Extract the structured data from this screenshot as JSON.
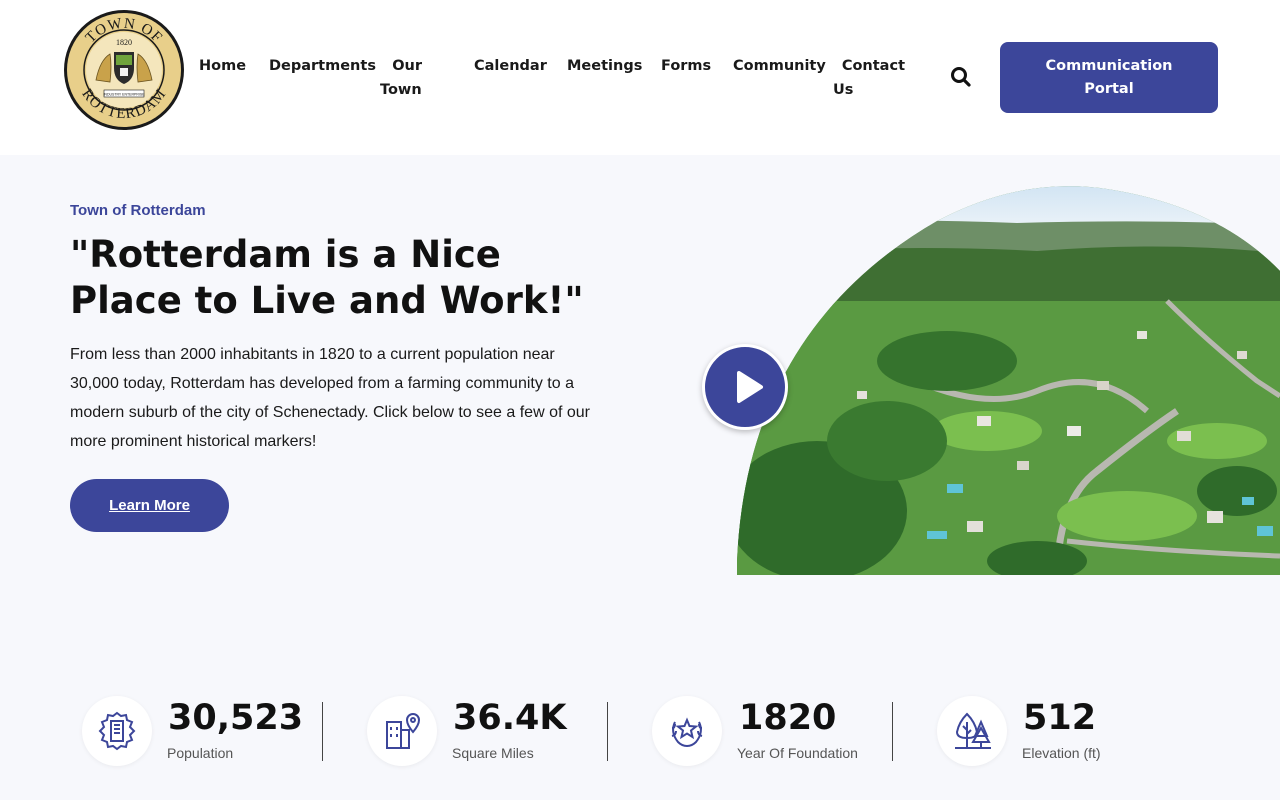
{
  "logo": {
    "top_text": "TOWN OF",
    "year": "1820",
    "bottom_text": "ROTTERDAM",
    "motto": "INDUSTRY ENTERPRISE"
  },
  "nav": {
    "home": "Home",
    "departments": "Departments",
    "our_town_1": "Our",
    "our_town_2": "Town",
    "calendar": "Calendar",
    "meetings": "Meetings",
    "forms": "Forms",
    "community": "Community",
    "contact_1": "Contact",
    "contact_2": "Us",
    "search_icon": "search-icon"
  },
  "portal": {
    "line1": "Communication",
    "line2": "Portal"
  },
  "hero": {
    "eyebrow": "Town of Rotterdam",
    "headline_1": "\"Rotterdam is a Nice",
    "headline_2": "Place to Live and Work!\"",
    "body": "From less than 2000 inhabitants in 1820 to a current population near 30,000 today, Rotterdam has developed from a farming community to a modern suburb of the city of Schenectady.  Click below to see a few of our more prominent historical markers!",
    "button": "Learn More",
    "play_icon": "play-icon"
  },
  "stats": [
    {
      "value": "30,523",
      "label": "Population",
      "icon": "city-gear-icon"
    },
    {
      "value": "36.4K",
      "label": "Square Miles",
      "icon": "building-location-icon"
    },
    {
      "value": "1820",
      "label": "Year Of Foundation",
      "icon": "laurel-star-icon"
    },
    {
      "value": "512",
      "label": "Elevation (ft)",
      "icon": "trees-icon"
    }
  ],
  "colors": {
    "brand": "#3c469a",
    "background": "#f7f8fc",
    "header": "#ffffff",
    "logo_gold": "#e8cf8a"
  }
}
